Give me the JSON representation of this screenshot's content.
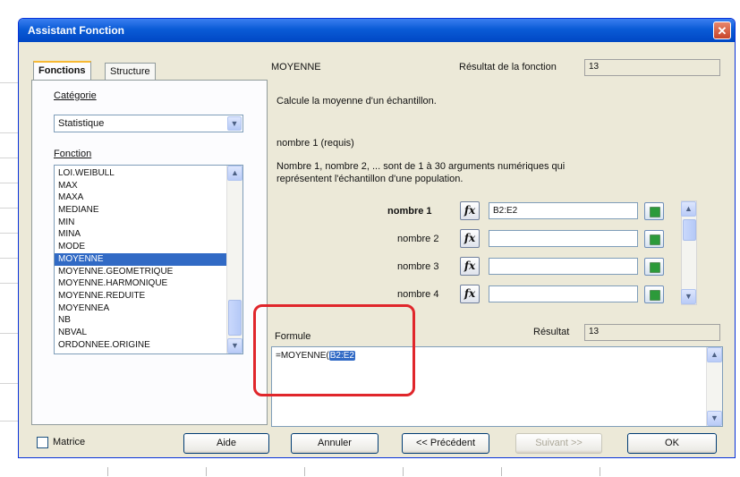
{
  "dialog": {
    "title": "Assistant Fonction",
    "close_glyph": "✕"
  },
  "tabs": [
    {
      "label": "Fonctions"
    },
    {
      "label": "Structure"
    }
  ],
  "category": {
    "label": "Catégorie",
    "value": "Statistique"
  },
  "function_list": {
    "label": "Fonction",
    "items": [
      "LOI.WEIBULL",
      "MAX",
      "MAXA",
      "MEDIANE",
      "MIN",
      "MINA",
      "MODE",
      "MOYENNE",
      "MOYENNE.GEOMETRIQUE",
      "MOYENNE.HARMONIQUE",
      "MOYENNE.REDUITE",
      "MOYENNEA",
      "NB",
      "NBVAL",
      "ORDONNEE.ORIGINE"
    ],
    "selected": "MOYENNE"
  },
  "function_info": {
    "name": "MOYENNE",
    "result_label": "Résultat de la fonction",
    "result_value": "13",
    "description": "Calcule la moyenne d'un échantillon.",
    "param_title": "nombre 1 (requis)",
    "param_desc_line1": "Nombre 1, nombre 2, ... sont de 1 à 30 arguments numériques qui",
    "param_desc_line2": "représentent l'échantillon d'une population."
  },
  "arguments": [
    {
      "label": "nombre 1",
      "value": "B2:E2"
    },
    {
      "label": "nombre 2",
      "value": ""
    },
    {
      "label": "nombre 3",
      "value": ""
    },
    {
      "label": "nombre 4",
      "value": ""
    }
  ],
  "fx_glyph": "fx",
  "formula": {
    "label": "Formule",
    "prefix": "=MOYENNE(",
    "selected_arg": "B2:E2",
    "result_label": "Résultat",
    "result_value": "13"
  },
  "matrix": {
    "label": "Matrice",
    "checked": false
  },
  "buttons": {
    "help": "Aide",
    "cancel": "Annuler",
    "previous": "<< Précédent",
    "next": "Suivant >>",
    "ok": "OK"
  },
  "scroll_glyphs": {
    "up": "▲",
    "down": "▼",
    "combo": "▼"
  }
}
